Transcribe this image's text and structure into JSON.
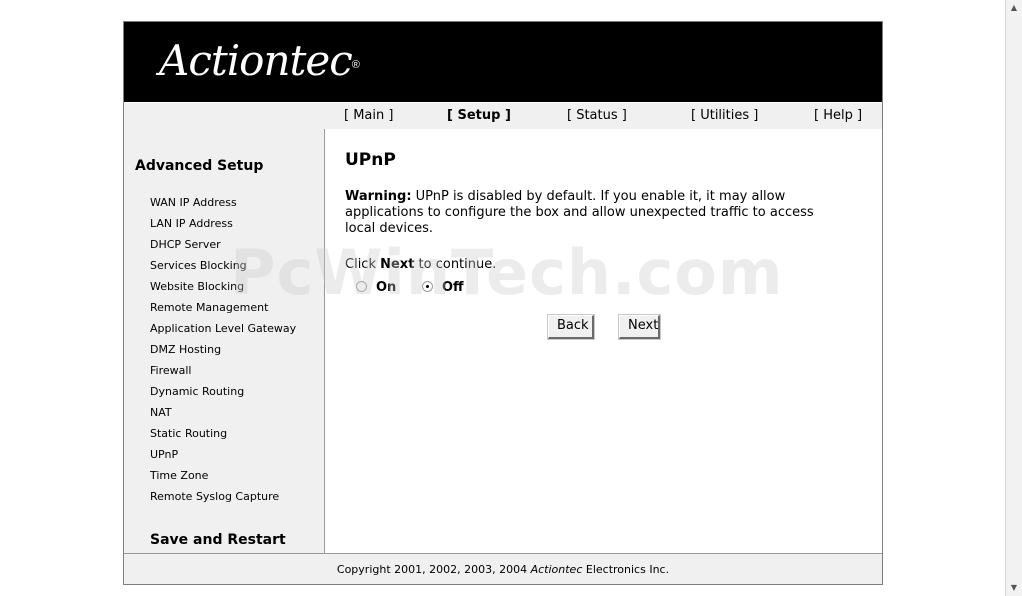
{
  "logo": {
    "text": "Actiontec",
    "mark": "®"
  },
  "nav": [
    {
      "label": "[ Main ]",
      "active": false
    },
    {
      "label": "[ Setup ]",
      "active": true
    },
    {
      "label": "[ Status ]",
      "active": false
    },
    {
      "label": "[ Utilities ]",
      "active": false
    },
    {
      "label": "[ Help ]",
      "active": false
    }
  ],
  "sidebar": {
    "title": "Advanced Setup",
    "items": [
      {
        "label": "WAN IP Address"
      },
      {
        "label": "LAN IP Address"
      },
      {
        "label": "DHCP Server"
      },
      {
        "label": "Services Blocking"
      },
      {
        "label": "Website Blocking"
      },
      {
        "label": "Remote Management"
      },
      {
        "label": "Application Level Gateway"
      },
      {
        "label": "DMZ Hosting"
      },
      {
        "label": "Firewall"
      },
      {
        "label": "Dynamic Routing"
      },
      {
        "label": "NAT"
      },
      {
        "label": "Static Routing"
      },
      {
        "label": "UPnP"
      },
      {
        "label": "Time Zone"
      },
      {
        "label": "Remote Syslog Capture"
      }
    ],
    "save_restart": "Save and Restart"
  },
  "main": {
    "title": "UPnP",
    "warning_label": "Warning:",
    "warning_text": " UPnP is disabled by default. If you enable it, it may allow applications to configure the box and allow unexpected traffic to access local devices.",
    "instruction_prefix": "Click ",
    "instruction_bold": "Next",
    "instruction_suffix": " to continue.",
    "radio_on": "On",
    "radio_off": "Off",
    "selected": "Off",
    "back_label": "Back",
    "next_label": "Next"
  },
  "footer": {
    "prefix": "Copyright 2001, 2002, 2003, 2004 ",
    "brand": "Actiontec",
    "suffix": " Electronics Inc."
  },
  "watermark": "PcWinTech.com"
}
